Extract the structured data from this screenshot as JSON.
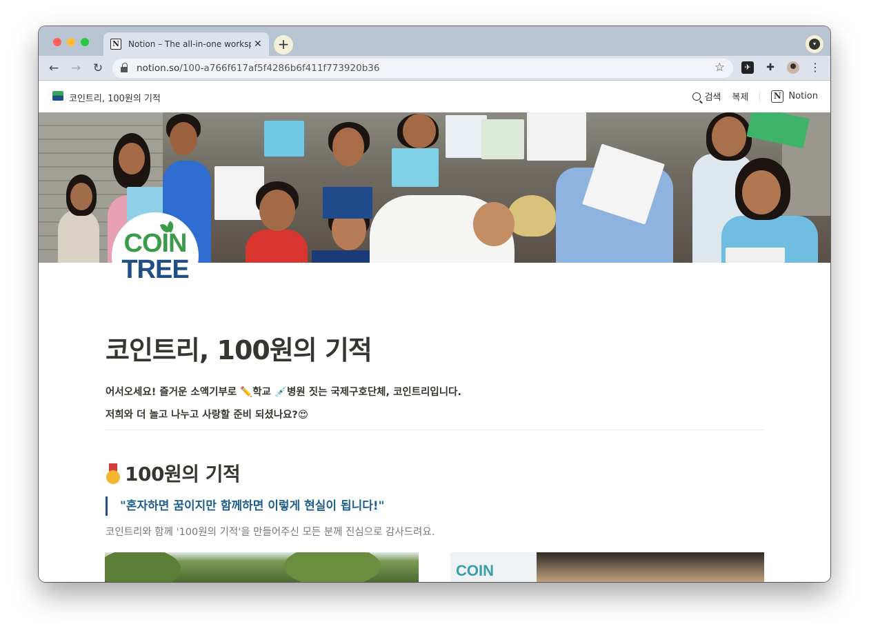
{
  "browser": {
    "tab_title": "Notion – The all-in-one workspace",
    "tab_favicon": "N",
    "close_glyph": "✕",
    "new_tab_glyph": "+",
    "url_host": "notion.so",
    "url_path": "/100-a766f617af5f4286b6f411f773920b36",
    "icons": [
      "back-icon",
      "forward-icon",
      "reload-icon",
      "lock-icon",
      "star-icon",
      "extension-icon",
      "puzzle-icon",
      "profile-avatar",
      "menu-icon"
    ]
  },
  "notion_header": {
    "page_title": "코인트리, 100원의 기적",
    "search_label": "검색",
    "duplicate_label": "복제",
    "notion_label": "Notion",
    "notion_logo": "N"
  },
  "cover": {
    "logo_line1": "COIN",
    "logo_line2": "TREE",
    "colors": {
      "green": "#3a9b48",
      "blue": "#1f4f86"
    }
  },
  "page": {
    "title": "코인트리, 100원의 기적",
    "intro_line1": "어서오세요! 즐거운 소액기부로 ✏️학교 💉병원 짓는 국제구호단체, 코인트리입니다.",
    "intro_line2": "저희와 더 놀고 나누고 사랑할 준비 되셨나요?😍",
    "section_heading": "100원의 기적",
    "quote": "\"혼자하면 꿈이지만 함께하면 이렇게 현실이 됩니다!\"",
    "subtext": "코인트리와 함께 '100원의 기적'을 만들어주신 모든 분께 진심으로 감사드려요.",
    "photo2_text": "COIN TREE"
  }
}
